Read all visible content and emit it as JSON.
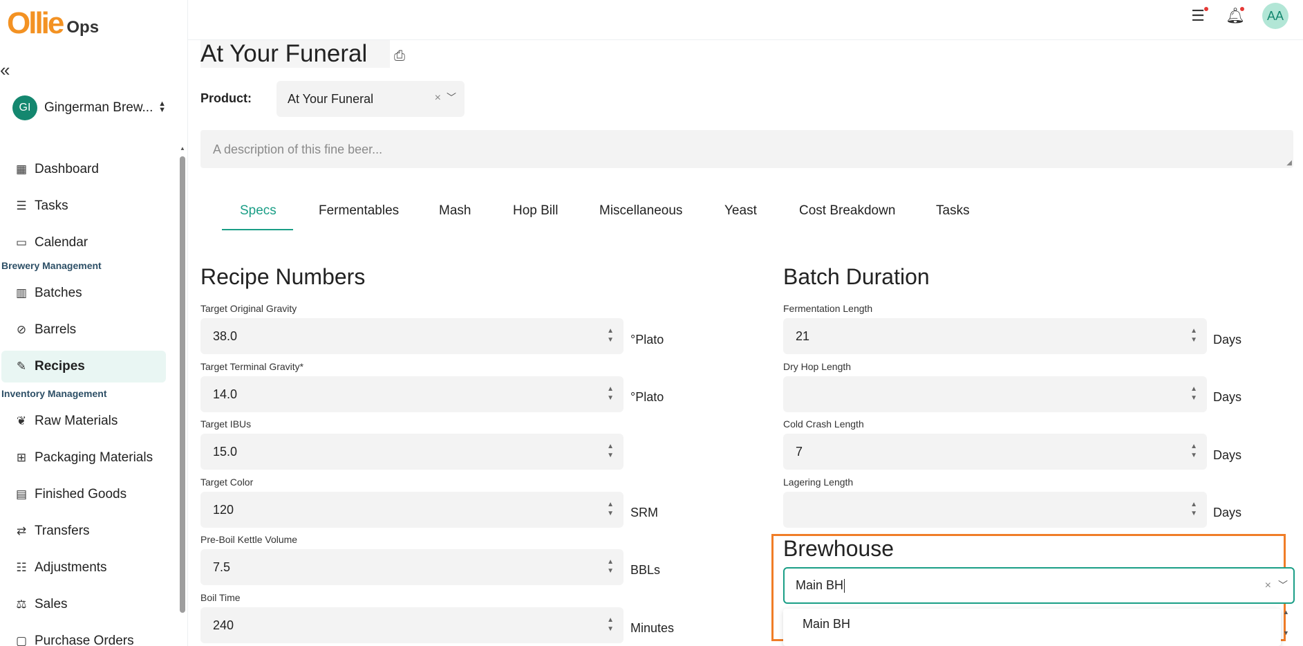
{
  "brand": {
    "logo_main": "Ollie",
    "logo_sub": "Ops",
    "logo_color": "#f39223"
  },
  "sidebar": {
    "collapse_icon": "double-chevron-left-icon",
    "org": {
      "initials": "GI",
      "name": "Gingerman Brew...",
      "avatar_color": "#14876f"
    },
    "items": [
      {
        "label": "Dashboard",
        "icon": "dashboard-icon"
      },
      {
        "label": "Tasks",
        "icon": "tasks-icon"
      },
      {
        "label": "Calendar",
        "icon": "calendar-icon"
      },
      {
        "label": "Batches",
        "icon": "batches-icon"
      },
      {
        "label": "Barrels",
        "icon": "barrels-icon"
      },
      {
        "label": "Recipes",
        "icon": "recipes-icon",
        "active": true
      },
      {
        "label": "Raw Materials",
        "icon": "raw-materials-icon"
      },
      {
        "label": "Packaging Materials",
        "icon": "packaging-icon"
      },
      {
        "label": "Finished Goods",
        "icon": "finished-goods-icon"
      },
      {
        "label": "Transfers",
        "icon": "transfers-icon"
      },
      {
        "label": "Adjustments",
        "icon": "adjustments-icon"
      },
      {
        "label": "Sales",
        "icon": "sales-icon"
      },
      {
        "label": "Purchase Orders",
        "icon": "purchase-orders-icon"
      }
    ],
    "sections": {
      "brewery": "Brewery Management",
      "inventory": "Inventory Management"
    }
  },
  "header": {
    "user_initials": "AA",
    "accent": "#1a9e86"
  },
  "recipe": {
    "title": "At Your Funeral",
    "product_label": "Product:",
    "product_value": "At Your Funeral",
    "description_placeholder": "A description of this fine beer..."
  },
  "tabs": [
    "Specs",
    "Fermentables",
    "Mash",
    "Hop Bill",
    "Miscellaneous",
    "Yeast",
    "Cost Breakdown",
    "Tasks"
  ],
  "recipe_numbers": {
    "title": "Recipe Numbers",
    "fields": [
      {
        "label": "Target Original Gravity",
        "value": "38.0",
        "unit": "°Plato"
      },
      {
        "label": "Target Terminal Gravity*",
        "value": "14.0",
        "unit": "°Plato"
      },
      {
        "label": "Target IBUs",
        "value": "15.0",
        "unit": ""
      },
      {
        "label": "Target Color",
        "value": "120",
        "unit": "SRM"
      },
      {
        "label": "Pre-Boil Kettle Volume",
        "value": "7.5",
        "unit": "BBLs"
      },
      {
        "label": "Boil Time",
        "value": "240",
        "unit": "Minutes"
      }
    ]
  },
  "batch_duration": {
    "title": "Batch Duration",
    "fields": [
      {
        "label": "Fermentation Length",
        "value": "21",
        "unit": "Days"
      },
      {
        "label": "Dry Hop Length",
        "value": "",
        "unit": "Days"
      },
      {
        "label": "Cold Crash Length",
        "value": "7",
        "unit": "Days"
      },
      {
        "label": "Lagering Length",
        "value": "",
        "unit": "Days"
      }
    ]
  },
  "brewhouse": {
    "title": "Brewhouse",
    "input_value": "Main BH",
    "options": [
      "Main BH"
    ],
    "highlight_color": "#f07d27"
  }
}
